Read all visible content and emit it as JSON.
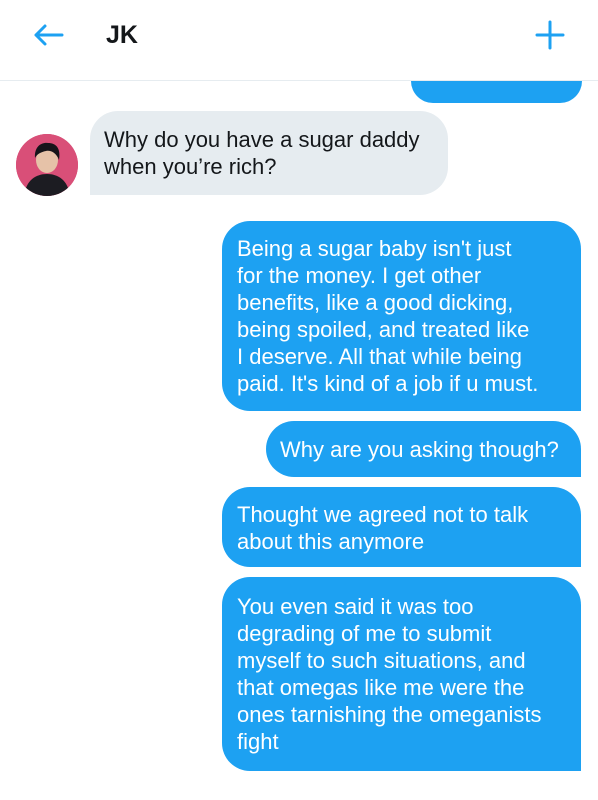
{
  "header": {
    "title": "JK",
    "back_icon": "arrow-left-icon",
    "add_icon": "plus-icon"
  },
  "colors": {
    "accent": "#1da1f2",
    "received_bubble": "#e6ecf0",
    "avatar_bg": "#d94f78"
  },
  "messages": [
    {
      "from": "JK",
      "text": "Why do you have a sugar daddy\nwhen you’re rich?"
    },
    {
      "from": "me",
      "text": "Being a sugar baby isn't just\nfor the money. I get other\nbenefits, like a good dicking,\nbeing spoiled, and treated like\nI deserve. All that while being\npaid. It's kind of a job if u must."
    },
    {
      "from": "me",
      "text": "Why are you asking though?"
    },
    {
      "from": "me",
      "text": "Thought we agreed not to talk\nabout this anymore"
    },
    {
      "from": "me",
      "text": "You even said it was too\ndegrading of me to submit\nmyself to such situations, and\nthat omegas like me were the\nones tarnishing the omeganists\nfight"
    }
  ]
}
